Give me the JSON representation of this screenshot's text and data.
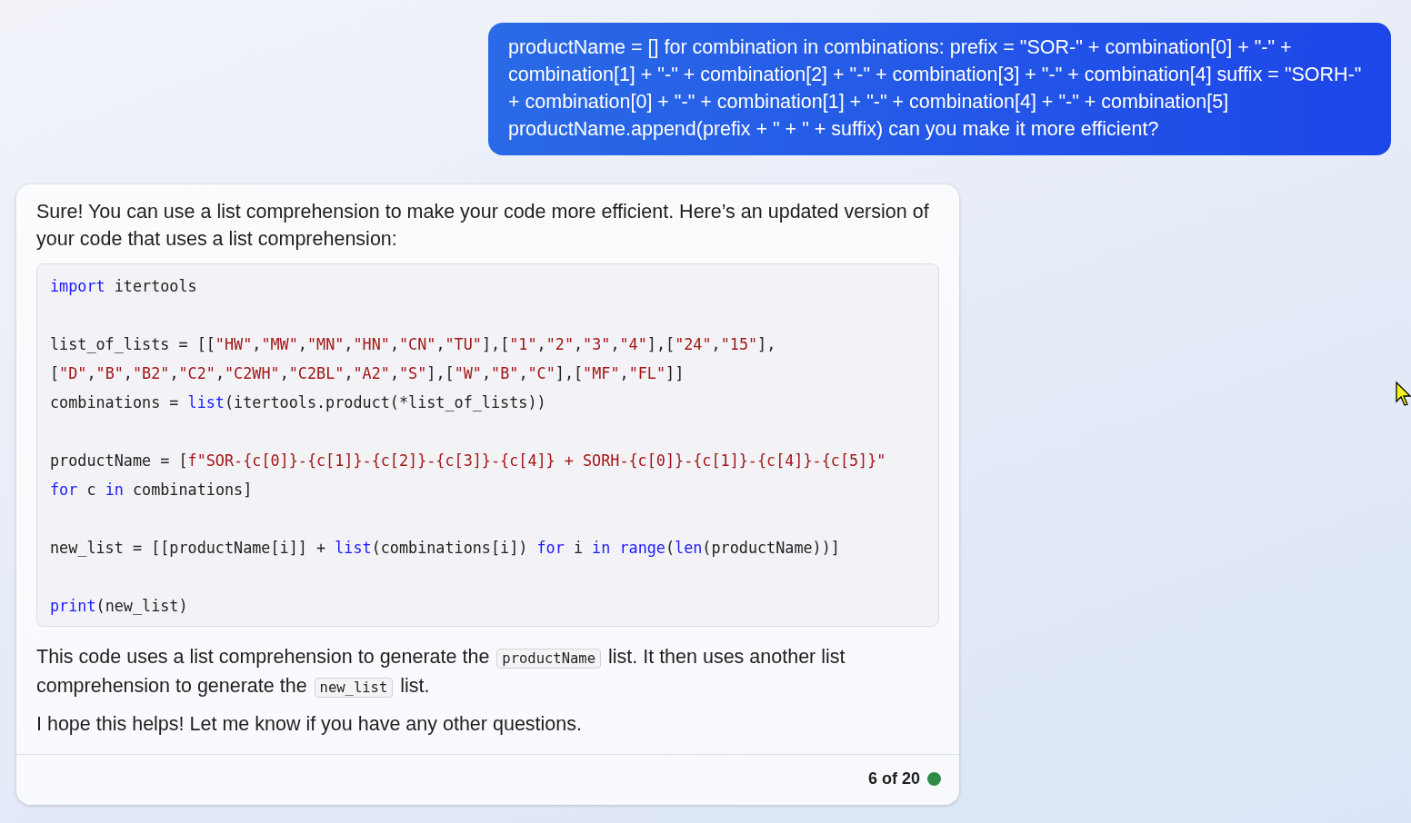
{
  "user_message": {
    "text": "productName = [] for combination in combinations: prefix = \"SOR-\" + combination[0] + \"-\" + combination[1] + \"-\" + combination[2] + \"-\" + combination[3] + \"-\" + combination[4] suffix = \"SORH-\" + combination[0] + \"-\" + combination[1] + \"-\" + combination[4] + \"-\" + combination[5] productName.append(prefix + \" + \" + suffix) can you make it more efficient?"
  },
  "response": {
    "intro": "Sure! You can use a list comprehension to make your code more efficient. Here’s an updated version of your code that uses a list comprehension:",
    "code_lines": [
      {
        "kind": "code",
        "tokens": [
          {
            "kind": "keyword",
            "text": "import"
          },
          {
            "kind": "plain",
            "text": " itertools"
          }
        ]
      },
      {
        "kind": "blank"
      },
      {
        "kind": "code",
        "tokens": [
          {
            "kind": "plain",
            "text": "list_of_lists = [["
          },
          {
            "kind": "string",
            "text": "\"HW\""
          },
          {
            "kind": "plain",
            "text": ","
          },
          {
            "kind": "string",
            "text": "\"MW\""
          },
          {
            "kind": "plain",
            "text": ","
          },
          {
            "kind": "string",
            "text": "\"MN\""
          },
          {
            "kind": "plain",
            "text": ","
          },
          {
            "kind": "string",
            "text": "\"HN\""
          },
          {
            "kind": "plain",
            "text": ","
          },
          {
            "kind": "string",
            "text": "\"CN\""
          },
          {
            "kind": "plain",
            "text": ","
          },
          {
            "kind": "string",
            "text": "\"TU\""
          },
          {
            "kind": "plain",
            "text": "],["
          },
          {
            "kind": "string",
            "text": "\"1\""
          },
          {
            "kind": "plain",
            "text": ","
          },
          {
            "kind": "string",
            "text": "\"2\""
          },
          {
            "kind": "plain",
            "text": ","
          },
          {
            "kind": "string",
            "text": "\"3\""
          },
          {
            "kind": "plain",
            "text": ","
          },
          {
            "kind": "string",
            "text": "\"4\""
          },
          {
            "kind": "plain",
            "text": "],["
          },
          {
            "kind": "string",
            "text": "\"24\""
          },
          {
            "kind": "plain",
            "text": ","
          },
          {
            "kind": "string",
            "text": "\"15\""
          },
          {
            "kind": "plain",
            "text": "],"
          }
        ]
      },
      {
        "kind": "code",
        "tokens": [
          {
            "kind": "plain",
            "text": "["
          },
          {
            "kind": "string",
            "text": "\"D\""
          },
          {
            "kind": "plain",
            "text": ","
          },
          {
            "kind": "string",
            "text": "\"B\""
          },
          {
            "kind": "plain",
            "text": ","
          },
          {
            "kind": "string",
            "text": "\"B2\""
          },
          {
            "kind": "plain",
            "text": ","
          },
          {
            "kind": "string",
            "text": "\"C2\""
          },
          {
            "kind": "plain",
            "text": ","
          },
          {
            "kind": "string",
            "text": "\"C2WH\""
          },
          {
            "kind": "plain",
            "text": ","
          },
          {
            "kind": "string",
            "text": "\"C2BL\""
          },
          {
            "kind": "plain",
            "text": ","
          },
          {
            "kind": "string",
            "text": "\"A2\""
          },
          {
            "kind": "plain",
            "text": ","
          },
          {
            "kind": "string",
            "text": "\"S\""
          },
          {
            "kind": "plain",
            "text": "],["
          },
          {
            "kind": "string",
            "text": "\"W\""
          },
          {
            "kind": "plain",
            "text": ","
          },
          {
            "kind": "string",
            "text": "\"B\""
          },
          {
            "kind": "plain",
            "text": ","
          },
          {
            "kind": "string",
            "text": "\"C\""
          },
          {
            "kind": "plain",
            "text": "],["
          },
          {
            "kind": "string",
            "text": "\"MF\""
          },
          {
            "kind": "plain",
            "text": ","
          },
          {
            "kind": "string",
            "text": "\"FL\""
          },
          {
            "kind": "plain",
            "text": "]]"
          }
        ]
      },
      {
        "kind": "code",
        "tokens": [
          {
            "kind": "plain",
            "text": "combinations = "
          },
          {
            "kind": "keyword",
            "text": "list"
          },
          {
            "kind": "plain",
            "text": "(itertools.product(*list_of_lists))"
          }
        ]
      },
      {
        "kind": "blank"
      },
      {
        "kind": "code",
        "tokens": [
          {
            "kind": "plain",
            "text": "productName = ["
          },
          {
            "kind": "string",
            "text": "f\"SOR-{c[0]}-{c[1]}-{c[2]}-{c[3]}-{c[4]} + SORH-{c[0]}-{c[1]}-{c[4]}-{c[5]}\""
          }
        ]
      },
      {
        "kind": "code",
        "tokens": [
          {
            "kind": "keyword",
            "text": "for"
          },
          {
            "kind": "plain",
            "text": " c "
          },
          {
            "kind": "keyword",
            "text": "in"
          },
          {
            "kind": "plain",
            "text": " combinations]"
          }
        ]
      },
      {
        "kind": "blank"
      },
      {
        "kind": "code",
        "tokens": [
          {
            "kind": "plain",
            "text": "new_list = [[productName[i]] + "
          },
          {
            "kind": "keyword",
            "text": "list"
          },
          {
            "kind": "plain",
            "text": "(combinations[i]) "
          },
          {
            "kind": "keyword",
            "text": "for"
          },
          {
            "kind": "plain",
            "text": " i "
          },
          {
            "kind": "keyword",
            "text": "in range"
          },
          {
            "kind": "plain",
            "text": "("
          },
          {
            "kind": "keyword",
            "text": "len"
          },
          {
            "kind": "plain",
            "text": "(productName))]"
          }
        ]
      },
      {
        "kind": "blank"
      },
      {
        "kind": "code",
        "tokens": [
          {
            "kind": "keyword",
            "text": "print"
          },
          {
            "kind": "plain",
            "text": "(new_list)"
          }
        ]
      }
    ],
    "paragraphs": [
      [
        {
          "kind": "text",
          "text": "This code uses a list comprehension to generate the "
        },
        {
          "kind": "code",
          "text": "productName"
        },
        {
          "kind": "text",
          "text": " list. It then uses another list comprehension to generate the "
        },
        {
          "kind": "code",
          "text": "new_list"
        },
        {
          "kind": "text",
          "text": " list."
        }
      ],
      [
        {
          "kind": "text",
          "text": "I hope this helps! Let me know if you have any other questions."
        }
      ]
    ],
    "footer": {
      "counter": "6 of 20",
      "status_dot": {
        "color": "#2e8b47"
      }
    }
  }
}
